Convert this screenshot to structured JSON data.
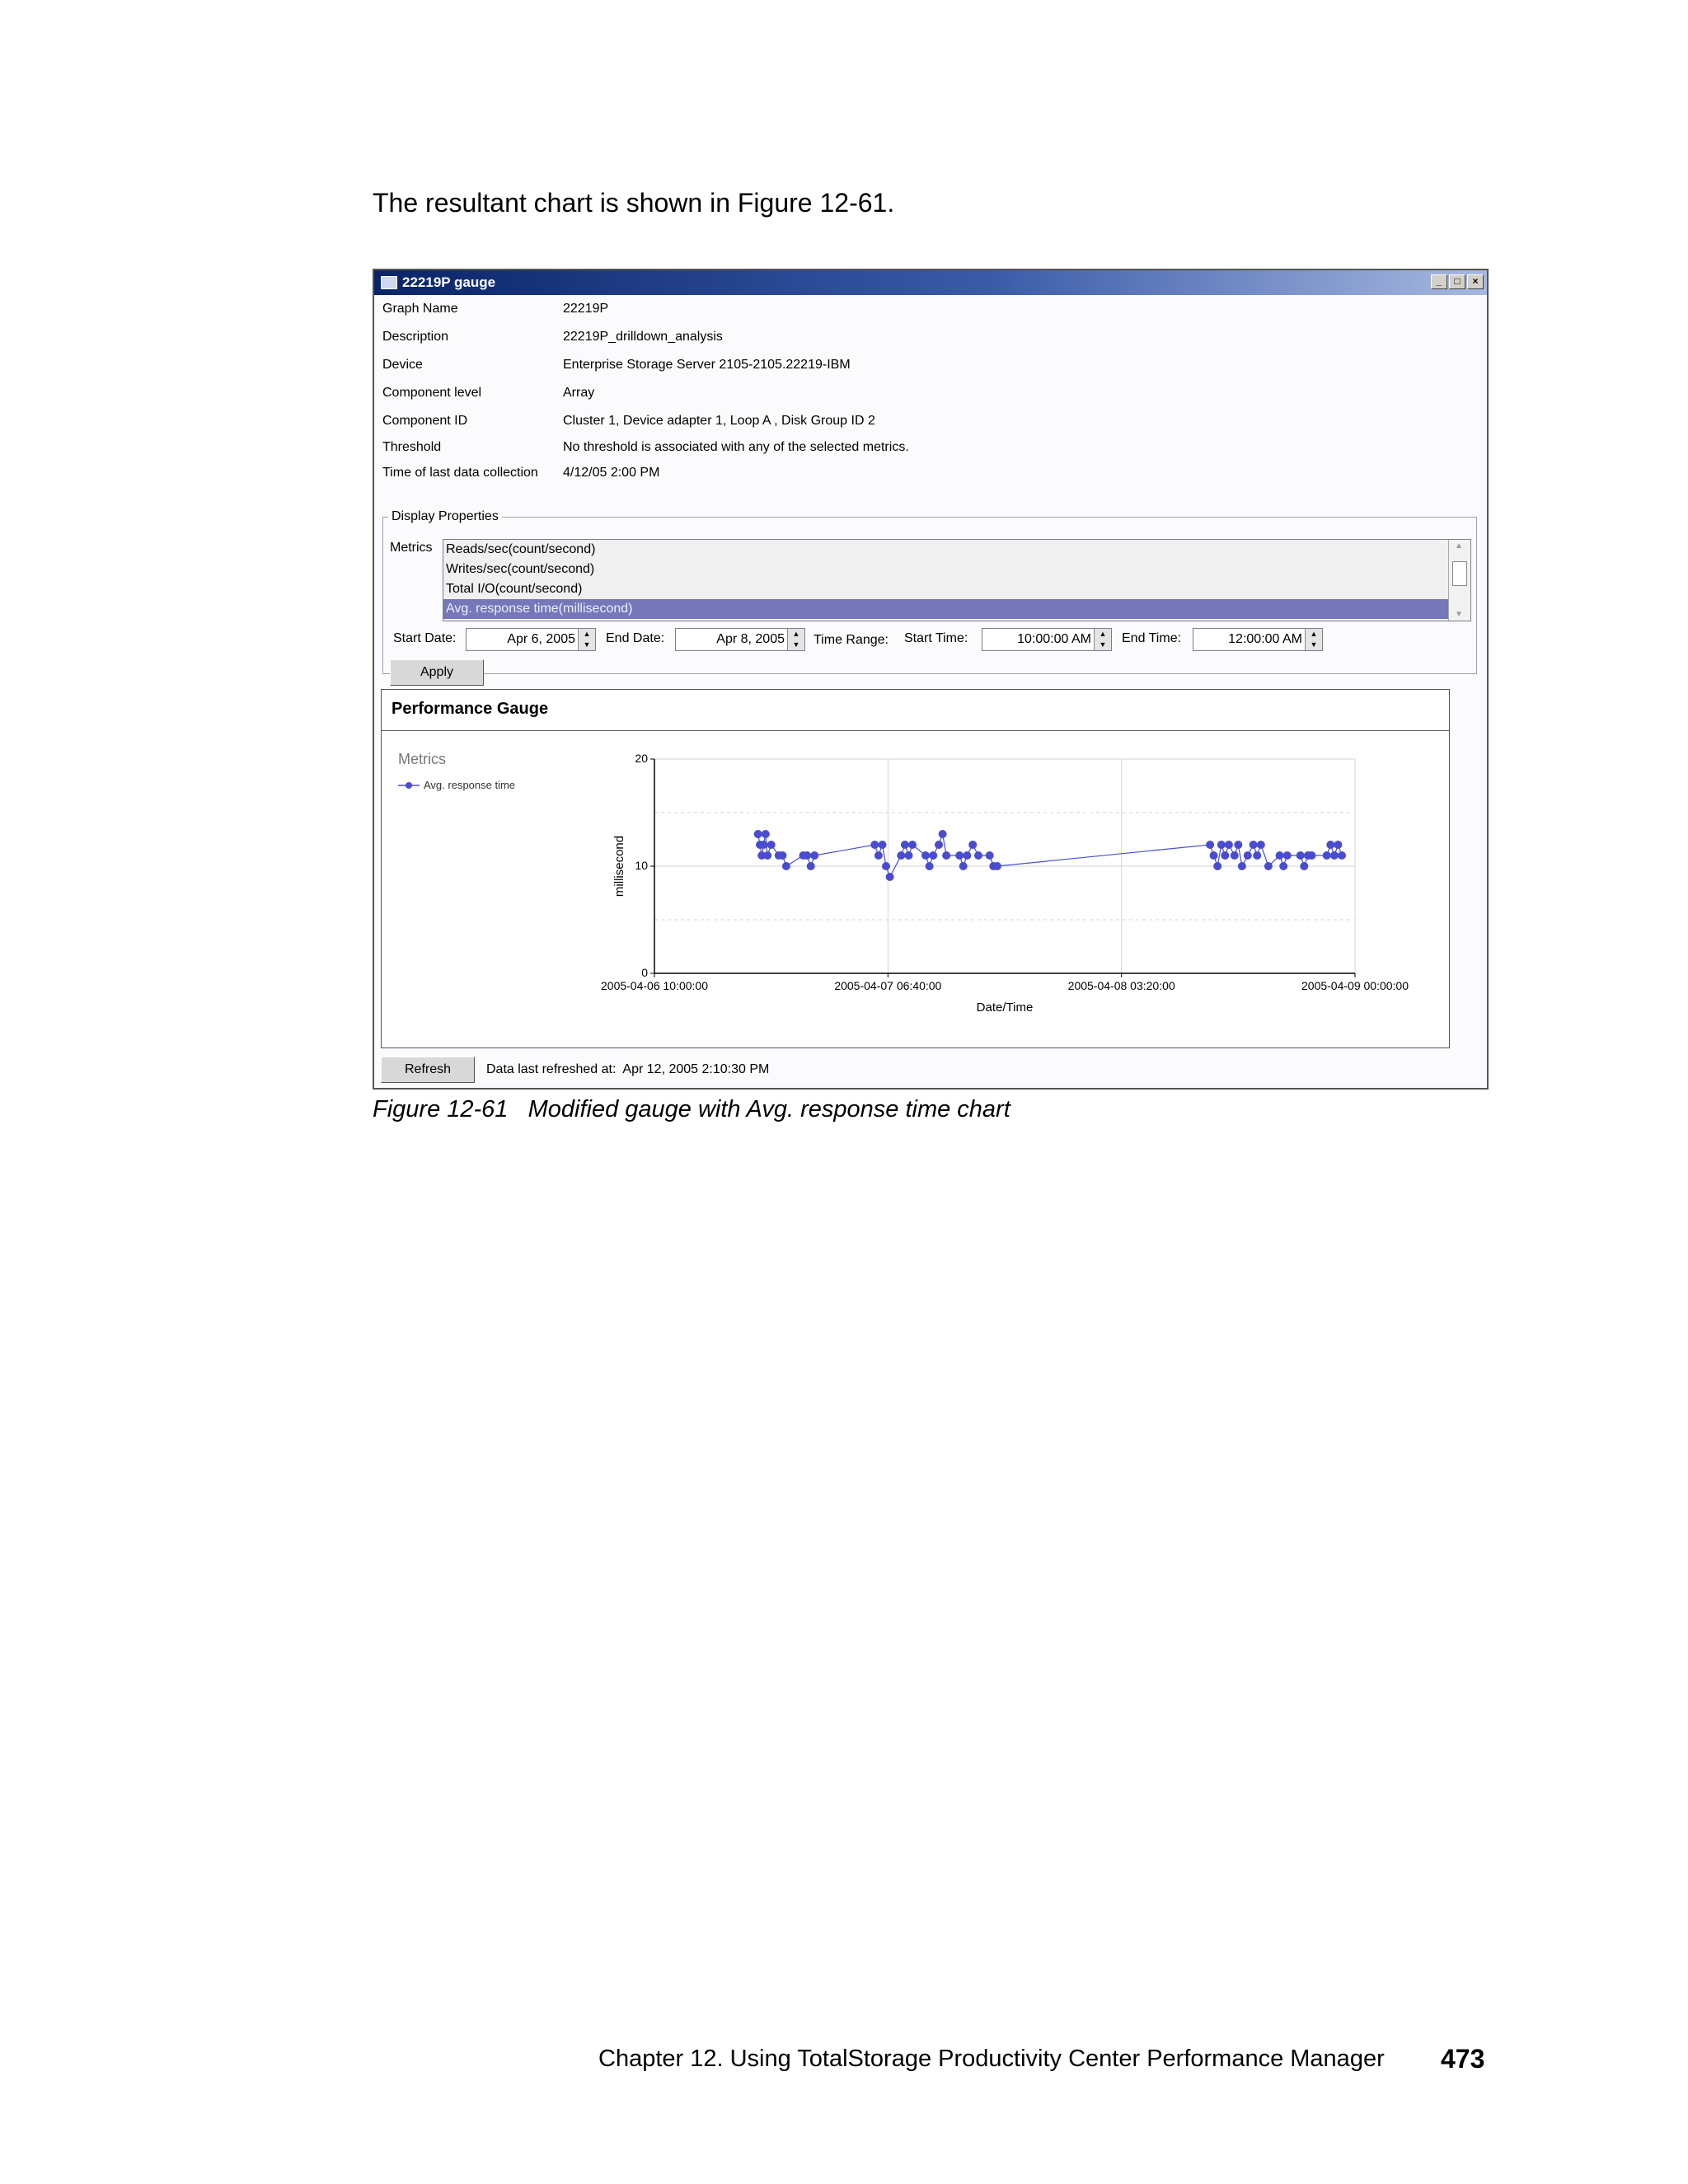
{
  "intro_text": "The resultant chart is shown in Figure 12-61.",
  "window": {
    "title": "22219P gauge",
    "controls": [
      "_",
      "□",
      "×"
    ]
  },
  "properties": [
    {
      "label": "Graph Name",
      "value": "22219P"
    },
    {
      "label": "Description",
      "value": "22219P_drilldown_analysis"
    },
    {
      "label": "Device",
      "value": "Enterprise Storage Server 2105-2105.22219-IBM"
    },
    {
      "label": "Component level",
      "value": "Array"
    },
    {
      "label": "Component ID",
      "value": "Cluster 1, Device adapter 1, Loop A , Disk Group ID 2"
    },
    {
      "label": "Threshold",
      "value": "No threshold is associated with any of the selected metrics."
    },
    {
      "label": "Time of last data collection",
      "value": "4/12/05 2:00 PM"
    }
  ],
  "display_properties": {
    "legend": "Display Properties",
    "metrics_label": "Metrics",
    "metrics": [
      {
        "label": "Reads/sec(count/second)",
        "selected": false
      },
      {
        "label": "Writes/sec(count/second)",
        "selected": false
      },
      {
        "label": "Total I/O(count/second)",
        "selected": false
      },
      {
        "label": "Avg. response time(millisecond)",
        "selected": true
      }
    ],
    "start_date_label": "Start Date:",
    "start_date": "Apr 6, 2005",
    "end_date_label": "End Date:",
    "end_date": "Apr 8, 2005",
    "time_range_label": "Time Range:",
    "start_time_label": "Start Time:",
    "start_time": "10:00:00 AM",
    "end_time_label": "End Time:",
    "end_time": "12:00:00 AM",
    "apply_label": "Apply"
  },
  "gauge": {
    "title": "Performance Gauge",
    "legend_title": "Metrics",
    "legend_series": "Avg. response time"
  },
  "status": {
    "refresh_label": "Refresh",
    "last_refreshed": "Data last refreshed at:  Apr 12, 2005 2:10:30 PM"
  },
  "chart_data": {
    "type": "line",
    "title": "",
    "xlabel": "Date/Time",
    "ylabel": "millisecond",
    "x_ticks": [
      "2005-04-06 10:00:00",
      "2005-04-07 06:40:00",
      "2005-04-08 03:20:00",
      "2005-04-09 00:00:00"
    ],
    "y_ticks": [
      0,
      10,
      20
    ],
    "ylim": [
      0,
      20
    ],
    "xlim": [
      "2005-04-06 10:00:00",
      "2005-04-09 00:00:00"
    ],
    "grid": true,
    "series_color": "#4a4ccf",
    "series": [
      {
        "name": "Avg. response time",
        "points": [
          [
            "2005-04-06 19:10",
            13
          ],
          [
            "2005-04-06 19:20",
            12
          ],
          [
            "2005-04-06 19:30",
            11
          ],
          [
            "2005-04-06 19:40",
            12
          ],
          [
            "2005-04-06 19:50",
            13
          ],
          [
            "2005-04-06 20:00",
            11
          ],
          [
            "2005-04-06 20:20",
            12
          ],
          [
            "2005-04-06 21:00",
            11
          ],
          [
            "2005-04-06 21:20",
            11
          ],
          [
            "2005-04-06 21:40",
            10
          ],
          [
            "2005-04-06 23:10",
            11
          ],
          [
            "2005-04-06 23:30",
            11
          ],
          [
            "2005-04-06 23:50",
            10
          ],
          [
            "2005-04-07 00:10",
            11
          ],
          [
            "2005-04-07 05:30",
            12
          ],
          [
            "2005-04-07 05:50",
            11
          ],
          [
            "2005-04-07 06:10",
            12
          ],
          [
            "2005-04-07 06:30",
            10
          ],
          [
            "2005-04-07 06:50",
            9
          ],
          [
            "2005-04-07 07:50",
            11
          ],
          [
            "2005-04-07 08:10",
            12
          ],
          [
            "2005-04-07 08:30",
            11
          ],
          [
            "2005-04-07 08:50",
            12
          ],
          [
            "2005-04-07 10:00",
            11
          ],
          [
            "2005-04-07 10:20",
            10
          ],
          [
            "2005-04-07 10:40",
            11
          ],
          [
            "2005-04-07 11:10",
            12
          ],
          [
            "2005-04-07 11:30",
            13
          ],
          [
            "2005-04-07 11:50",
            11
          ],
          [
            "2005-04-07 13:00",
            11
          ],
          [
            "2005-04-07 13:20",
            10
          ],
          [
            "2005-04-07 13:40",
            11
          ],
          [
            "2005-04-07 14:10",
            12
          ],
          [
            "2005-04-07 14:40",
            11
          ],
          [
            "2005-04-07 15:40",
            11
          ],
          [
            "2005-04-07 16:00",
            10
          ],
          [
            "2005-04-07 16:20",
            10
          ],
          [
            "2005-04-08 11:10",
            12
          ],
          [
            "2005-04-08 11:30",
            11
          ],
          [
            "2005-04-08 11:50",
            10
          ],
          [
            "2005-04-08 12:10",
            12
          ],
          [
            "2005-04-08 12:30",
            11
          ],
          [
            "2005-04-08 12:50",
            12
          ],
          [
            "2005-04-08 13:20",
            11
          ],
          [
            "2005-04-08 13:40",
            12
          ],
          [
            "2005-04-08 14:00",
            10
          ],
          [
            "2005-04-08 14:30",
            11
          ],
          [
            "2005-04-08 15:00",
            12
          ],
          [
            "2005-04-08 15:20",
            11
          ],
          [
            "2005-04-08 15:40",
            12
          ],
          [
            "2005-04-08 16:20",
            10
          ],
          [
            "2005-04-08 17:20",
            11
          ],
          [
            "2005-04-08 17:40",
            10
          ],
          [
            "2005-04-08 18:00",
            11
          ],
          [
            "2005-04-08 19:10",
            11
          ],
          [
            "2005-04-08 19:30",
            10
          ],
          [
            "2005-04-08 19:50",
            11
          ],
          [
            "2005-04-08 20:10",
            11
          ],
          [
            "2005-04-08 21:30",
            11
          ],
          [
            "2005-04-08 21:50",
            12
          ],
          [
            "2005-04-08 22:10",
            11
          ],
          [
            "2005-04-08 22:30",
            12
          ],
          [
            "2005-04-08 22:50",
            11
          ]
        ]
      }
    ]
  },
  "caption": "Figure 12-61   Modified gauge with Avg. response time chart",
  "footer": {
    "chapter": "Chapter 12. Using TotalStorage Productivity Center Performance Manager",
    "page_number": "473"
  }
}
